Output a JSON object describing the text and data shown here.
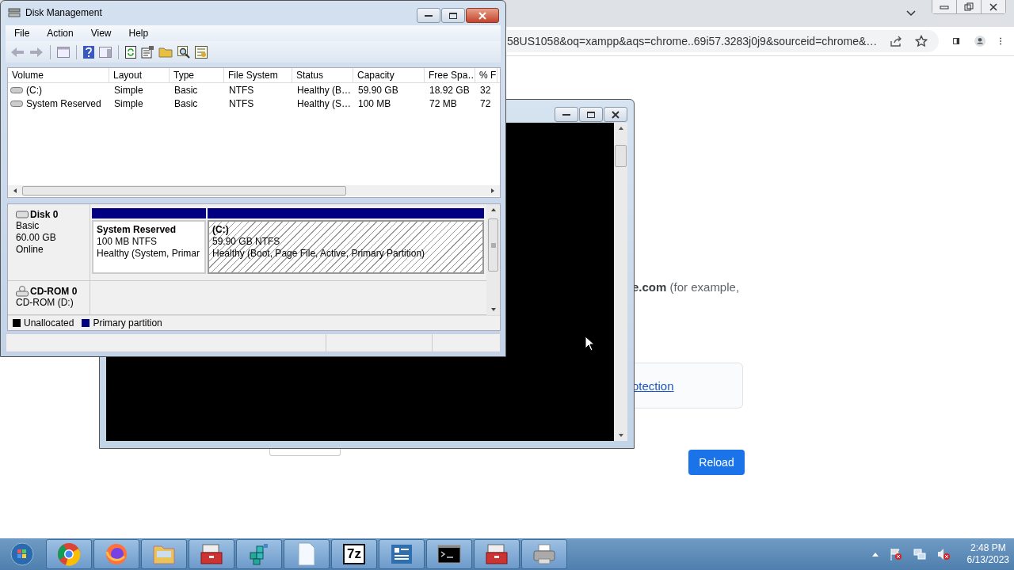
{
  "browser": {
    "address": "58US1058&oq=xampp&aqs=chrome..69i57.3283j0j9&sourceid=chrome&…",
    "message": "**e.com** (for example,",
    "link": "otection",
    "reload_button": "Reload"
  },
  "disk_management": {
    "title": "Disk Management",
    "menu": [
      "File",
      "Action",
      "View",
      "Help"
    ],
    "columns": [
      "Volume",
      "Layout",
      "Type",
      "File System",
      "Status",
      "Capacity",
      "Free Spa…",
      "% F"
    ],
    "rows": [
      {
        "cells": [
          "(C:)",
          "Simple",
          "Basic",
          "NTFS",
          "Healthy (B…",
          "59.90 GB",
          "18.92 GB",
          "32"
        ]
      },
      {
        "cells": [
          "System Reserved",
          "Simple",
          "Basic",
          "NTFS",
          "Healthy (S…",
          "100 MB",
          "72 MB",
          "72"
        ]
      }
    ],
    "disks": [
      {
        "kind": "disk",
        "name": "Disk 0",
        "details": [
          "Basic",
          "60.00 GB",
          "Online"
        ],
        "partitions": [
          {
            "name": "System Reserved",
            "details": [
              "100 MB NTFS",
              "Healthy (System, Primar"
            ],
            "selected": false
          },
          {
            "name": "(C:)",
            "details": [
              "59.90 GB NTFS",
              "Healthy (Boot, Page File, Active, Primary Partition)"
            ],
            "selected": true
          }
        ]
      },
      {
        "kind": "cdrom",
        "name": "CD-ROM 0",
        "details": [
          "CD-ROM (D:)"
        ]
      }
    ],
    "legend": [
      {
        "label": "Unallocated",
        "color": "#000000"
      },
      {
        "label": "Primary partition",
        "color": "#000080"
      }
    ]
  },
  "taskbar": {
    "apps": [
      {
        "kind": "chrome"
      },
      {
        "kind": "firefox"
      },
      {
        "kind": "explorer"
      },
      {
        "kind": "toolbox"
      },
      {
        "kind": "cubes"
      },
      {
        "kind": "document"
      },
      {
        "kind": "sevenzip",
        "label": "7z"
      },
      {
        "kind": "panel"
      },
      {
        "kind": "console"
      },
      {
        "kind": "toolbox"
      },
      {
        "kind": "printer"
      }
    ],
    "clock": {
      "time": "2:48 PM",
      "date": "6/13/2023"
    }
  }
}
